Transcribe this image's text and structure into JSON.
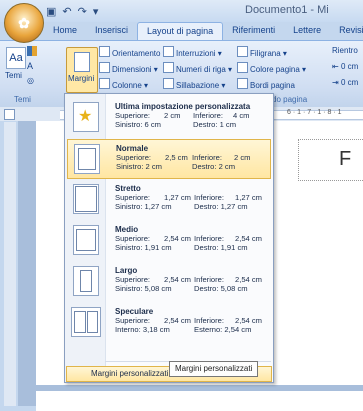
{
  "window": {
    "title": "Documento1 - Mi"
  },
  "tabs": [
    "Home",
    "Inserisci",
    "Layout di pagina",
    "Riferimenti",
    "Lettere",
    "Revisione"
  ],
  "ribbon": {
    "themes": {
      "label": "Temi",
      "group": "Temi"
    },
    "margins_label": "Margini",
    "orientation": "Orientamento",
    "size": "Dimensioni",
    "columns": "Colonne",
    "breaks": "Interruzioni",
    "line_numbers": "Numeri di riga",
    "hyphenation": "Sillabazione",
    "watermark": "Filigrana",
    "page_color": "Colore pagina",
    "page_borders": "Bordi pagina",
    "page_bg_group": "do pagina",
    "indent_group": "Rientro",
    "indent_left": "0 cm",
    "indent_right": "0 cm"
  },
  "margins_menu": {
    "options": [
      {
        "name": "Ultima impostazione personalizzata",
        "r1a": "Superiore:",
        "r1b": "2 cm",
        "r1c": "Inferiore:",
        "r1d": "4 cm",
        "r2a": "Sinistro: 6 cm",
        "r2b": "Destro:   1 cm"
      },
      {
        "name": "Normale",
        "r1a": "Superiore:",
        "r1b": "2,5 cm",
        "r1c": "Inferiore:",
        "r1d": "2 cm",
        "r2a": "Sinistro: 2 cm",
        "r2b": "Destro:   2 cm"
      },
      {
        "name": "Stretto",
        "r1a": "Superiore:",
        "r1b": "1,27 cm",
        "r1c": "Inferiore:",
        "r1d": "1,27 cm",
        "r2a": "Sinistro: 1,27 cm",
        "r2b": "Destro:  1,27 cm"
      },
      {
        "name": "Medio",
        "r1a": "Superiore:",
        "r1b": "2,54 cm",
        "r1c": "Inferiore:",
        "r1d": "2,54 cm",
        "r2a": "Sinistro: 1,91 cm",
        "r2b": "Destro:  1,91 cm"
      },
      {
        "name": "Largo",
        "r1a": "Superiore:",
        "r1b": "2,54 cm",
        "r1c": "Inferiore:",
        "r1d": "2,54 cm",
        "r2a": "Sinistro: 5,08 cm",
        "r2b": "Destro:  5,08 cm"
      },
      {
        "name": "Speculare",
        "r1a": "Superiore:",
        "r1b": "2,54 cm",
        "r1c": "Inferiore:",
        "r1d": "2,54 cm",
        "r2a": "Interno: 3,18 cm",
        "r2b": "Esterno: 2,54 cm"
      }
    ],
    "custom_label": "Margini personalizzati..."
  },
  "tooltip": "Margini personalizzati",
  "document": {
    "visible_letter": "F"
  },
  "ruler": {
    "marks": "6 · 1 · 7 · 1 · 8 · 1"
  }
}
